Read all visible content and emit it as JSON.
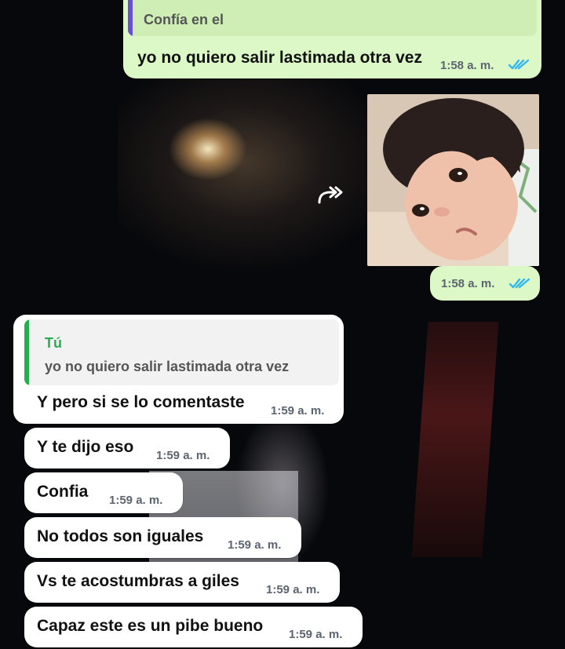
{
  "messages": {
    "out1": {
      "quote_text": "Confía en el",
      "text": "yo no quiero salir lastimada otra vez",
      "time": "1:58 a. m.",
      "status": "read"
    },
    "out_image": {
      "time": "1:58 a. m.",
      "status": "read",
      "forward_icon": "forward-icon"
    },
    "in1": {
      "quote_author": "Tú",
      "quote_text": "yo no quiero salir lastimada otra vez",
      "text": "Y pero si se lo comentaste",
      "time": "1:59 a. m."
    },
    "in2": {
      "text": "Y te dijo eso",
      "time": "1:59 a. m."
    },
    "in3": {
      "text": "Confia",
      "time": "1:59 a. m."
    },
    "in4": {
      "text": "No todos son iguales",
      "time": "1:59 a. m."
    },
    "in5": {
      "text": "Vs te acostumbras a giles",
      "time": "1:59 a. m."
    },
    "in6": {
      "text": "Capaz este es un pibe bueno",
      "time": "1:59 a. m."
    }
  },
  "colors": {
    "outgoing_bubble": "#dcf8c6",
    "incoming_bubble": "#ffffff",
    "read_ticks": "#34b7f1",
    "quote_bar_out": "#6a4ed8",
    "quote_bar_in": "#25b04f",
    "quote_author_in": "#25b04f"
  }
}
